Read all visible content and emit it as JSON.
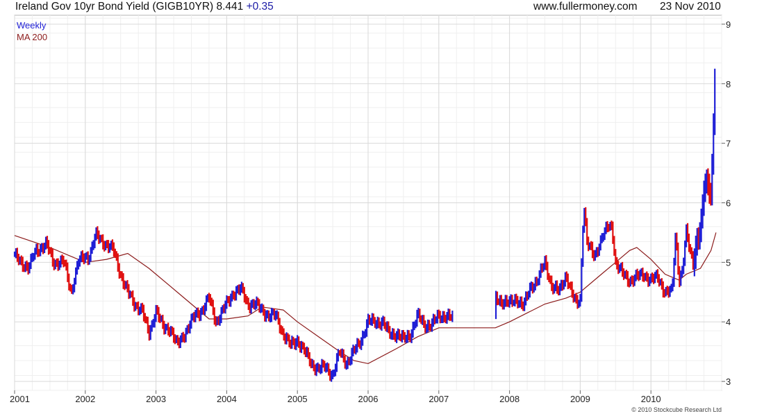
{
  "header": {
    "title": "Ireland Gov 10yr Bond Yield (GIGB10YR) 8.441",
    "change": "+0.35",
    "site": "www.fullermoney.com",
    "date": "23 Nov 2010"
  },
  "footer": {
    "copyright": "© 2010 Stockcube Research Ltd"
  },
  "colors": {
    "up": "#1f1fd6",
    "down": "#e01010",
    "ma": "#8b1a1a",
    "grid": "#d9d9d9",
    "frame": "#b5b5b5"
  },
  "chart_data": {
    "type": "line",
    "xlim": [
      2001.0,
      2011.0
    ],
    "ylim": [
      2.85,
      9.15
    ],
    "y_ticks": [
      3,
      4,
      5,
      6,
      7,
      8,
      9
    ],
    "x_ticks": [
      2001,
      2002,
      2003,
      2004,
      2005,
      2006,
      2007,
      2008,
      2009,
      2010
    ],
    "x_tick_labels": [
      "2001",
      "2002",
      "2003",
      "2004",
      "2005",
      "2006",
      "2007",
      "2008",
      "2009",
      "2010"
    ],
    "y_axis_side": "right",
    "grid": true,
    "legend_position": "top-left",
    "gaps": [
      [
        2007.2,
        2007.8
      ]
    ],
    "series": [
      {
        "name": "Weekly",
        "style": "bars-colored",
        "x": [
          2001.0,
          2001.1,
          2001.2,
          2001.3,
          2001.45,
          2001.55,
          2001.7,
          2001.8,
          2001.9,
          2002.0,
          2002.05,
          2002.15,
          2002.3,
          2002.4,
          2002.5,
          2002.6,
          2002.7,
          2002.8,
          2002.9,
          2003.0,
          2003.1,
          2003.2,
          2003.3,
          2003.45,
          2003.55,
          2003.65,
          2003.75,
          2003.85,
          2004.0,
          2004.1,
          2004.2,
          2004.3,
          2004.4,
          2004.5,
          2004.6,
          2004.7,
          2004.8,
          2004.9,
          2005.0,
          2005.1,
          2005.2,
          2005.3,
          2005.4,
          2005.5,
          2005.6,
          2005.7,
          2005.8,
          2005.9,
          2006.0,
          2006.1,
          2006.2,
          2006.3,
          2006.4,
          2006.5,
          2006.6,
          2006.7,
          2006.8,
          2006.9,
          2007.0,
          2007.1,
          2007.2,
          2007.8,
          2007.9,
          2008.0,
          2008.1,
          2008.2,
          2008.3,
          2008.4,
          2008.5,
          2008.6,
          2008.7,
          2008.8,
          2008.9,
          2008.95,
          2009.0,
          2009.05,
          2009.1,
          2009.2,
          2009.3,
          2009.4,
          2009.45,
          2009.5,
          2009.6,
          2009.7,
          2009.8,
          2009.9,
          2010.0,
          2010.1,
          2010.2,
          2010.3,
          2010.35,
          2010.4,
          2010.45,
          2010.5,
          2010.55,
          2010.6,
          2010.65,
          2010.7,
          2010.75,
          2010.8,
          2010.85,
          2010.88,
          2010.9,
          2010.92
        ],
        "values": [
          5.1,
          5.0,
          4.9,
          5.2,
          5.3,
          5.0,
          5.0,
          4.5,
          5.0,
          5.1,
          5.1,
          5.45,
          5.3,
          5.2,
          4.8,
          4.5,
          4.3,
          4.2,
          3.8,
          4.2,
          3.9,
          3.9,
          3.6,
          3.9,
          4.1,
          4.2,
          4.4,
          4.0,
          4.3,
          4.5,
          4.55,
          4.3,
          4.3,
          4.2,
          4.1,
          4.1,
          3.8,
          3.6,
          3.7,
          3.5,
          3.3,
          3.2,
          3.25,
          3.1,
          3.5,
          3.3,
          3.5,
          3.7,
          4.0,
          4.0,
          4.0,
          3.8,
          3.8,
          3.7,
          3.8,
          4.1,
          3.95,
          3.95,
          4.1,
          4.1,
          4.05,
          4.4,
          4.35,
          4.3,
          4.4,
          4.25,
          4.6,
          4.7,
          5.0,
          4.6,
          4.5,
          4.8,
          4.4,
          4.3,
          4.4,
          6.0,
          5.3,
          5.1,
          5.4,
          5.6,
          5.6,
          5.0,
          4.8,
          4.7,
          4.75,
          4.8,
          4.7,
          4.75,
          4.5,
          4.5,
          5.5,
          4.7,
          4.9,
          5.5,
          5.2,
          5.0,
          5.4,
          5.5,
          6.2,
          6.4,
          6.1,
          7.2,
          8.0,
          8.441
        ]
      },
      {
        "name": "MA 200",
        "style": "line",
        "x": [
          2001.0,
          2001.5,
          2002.0,
          2002.3,
          2002.6,
          2002.9,
          2003.2,
          2003.5,
          2003.75,
          2004.0,
          2004.3,
          2004.5,
          2004.8,
          2005.0,
          2005.3,
          2005.6,
          2005.8,
          2006.0,
          2006.4,
          2006.7,
          2007.0,
          2007.3,
          2007.8,
          2008.0,
          2008.5,
          2008.8,
          2009.0,
          2009.3,
          2009.5,
          2009.7,
          2009.8,
          2010.0,
          2010.2,
          2010.4,
          2010.5,
          2010.7,
          2010.85,
          2010.92
        ],
        "values": [
          5.45,
          5.25,
          5.0,
          5.05,
          5.15,
          4.9,
          4.6,
          4.3,
          4.05,
          4.05,
          4.1,
          4.25,
          4.2,
          4.0,
          3.75,
          3.5,
          3.35,
          3.3,
          3.55,
          3.75,
          3.9,
          3.9,
          3.9,
          4.0,
          4.3,
          4.4,
          4.5,
          4.8,
          5.0,
          5.2,
          5.25,
          5.05,
          4.8,
          4.7,
          4.8,
          4.9,
          5.2,
          5.5
        ]
      }
    ]
  }
}
